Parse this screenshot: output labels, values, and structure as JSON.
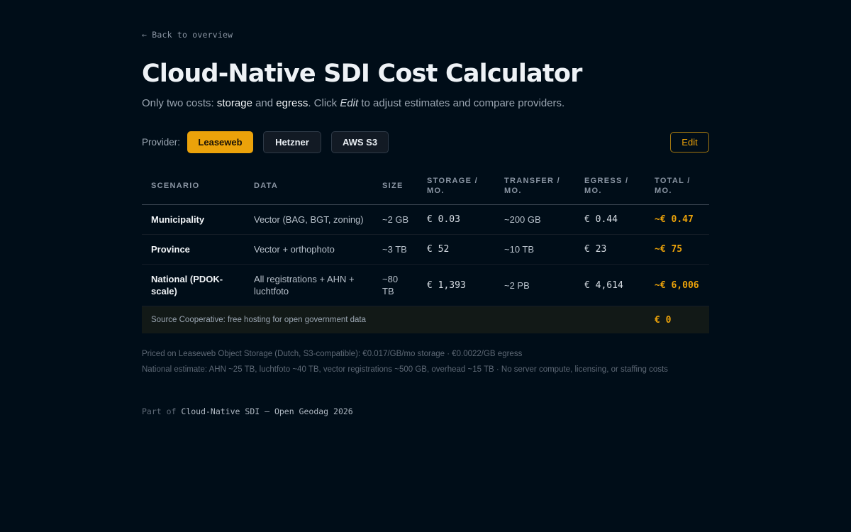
{
  "nav": {
    "back_label": "← Back to overview"
  },
  "header": {
    "title": "Cloud-Native SDI Cost Calculator",
    "subtitle": {
      "part1": "Only two costs: ",
      "storage": "storage",
      "part2": " and ",
      "egress": "egress",
      "part3": ". Click ",
      "edit": "Edit",
      "part4": " to adjust estimates and compare providers."
    }
  },
  "providers": {
    "label": "Provider:",
    "options": [
      "Leaseweb",
      "Hetzner",
      "AWS S3"
    ],
    "selected": "Leaseweb",
    "edit_label": "Edit"
  },
  "table": {
    "headers": [
      "SCENARIO",
      "DATA",
      "SIZE",
      "STORAGE / MO.",
      "TRANSFER / MO.",
      "EGRESS / MO.",
      "TOTAL / MO."
    ],
    "rows": [
      {
        "scenario": "Municipality",
        "data": "Vector (BAG, BGT, zoning)",
        "size": "~2 GB",
        "storage": "€ 0.03",
        "transfer": "~200 GB",
        "egress": "€ 0.44",
        "total": "~€ 0.47"
      },
      {
        "scenario": "Province",
        "data": "Vector + orthophoto",
        "size": "~3 TB",
        "storage": "€ 52",
        "transfer": "~10 TB",
        "egress": "€ 23",
        "total": "~€ 75"
      },
      {
        "scenario": "National (PDOK-scale)",
        "data": "All registrations + AHN + luchtfoto",
        "size": "~80 TB",
        "storage": "€ 1,393",
        "transfer": "~2 PB",
        "egress": "€ 4,614",
        "total": "~€ 6,006"
      }
    ],
    "source_row": {
      "label": "Source Cooperative: free hosting for open government data",
      "total": "€ 0"
    }
  },
  "notes": {
    "pricing": "Priced on Leaseweb Object Storage (Dutch, S3-compatible): €0.017/GB/mo storage · €0.0022/GB egress",
    "estimate": "National estimate: AHN ~25 TB, luchtfoto ~40 TB, vector registrations ~500 GB, overhead ~15 TB · No server compute, licensing, or staffing costs"
  },
  "footer": {
    "prefix": "Part of ",
    "link": "Cloud-Native SDI — Open Geodag 2026"
  },
  "colors": {
    "background": "#000d18",
    "accent": "#eba20a",
    "source_row_bg": "#121917"
  }
}
